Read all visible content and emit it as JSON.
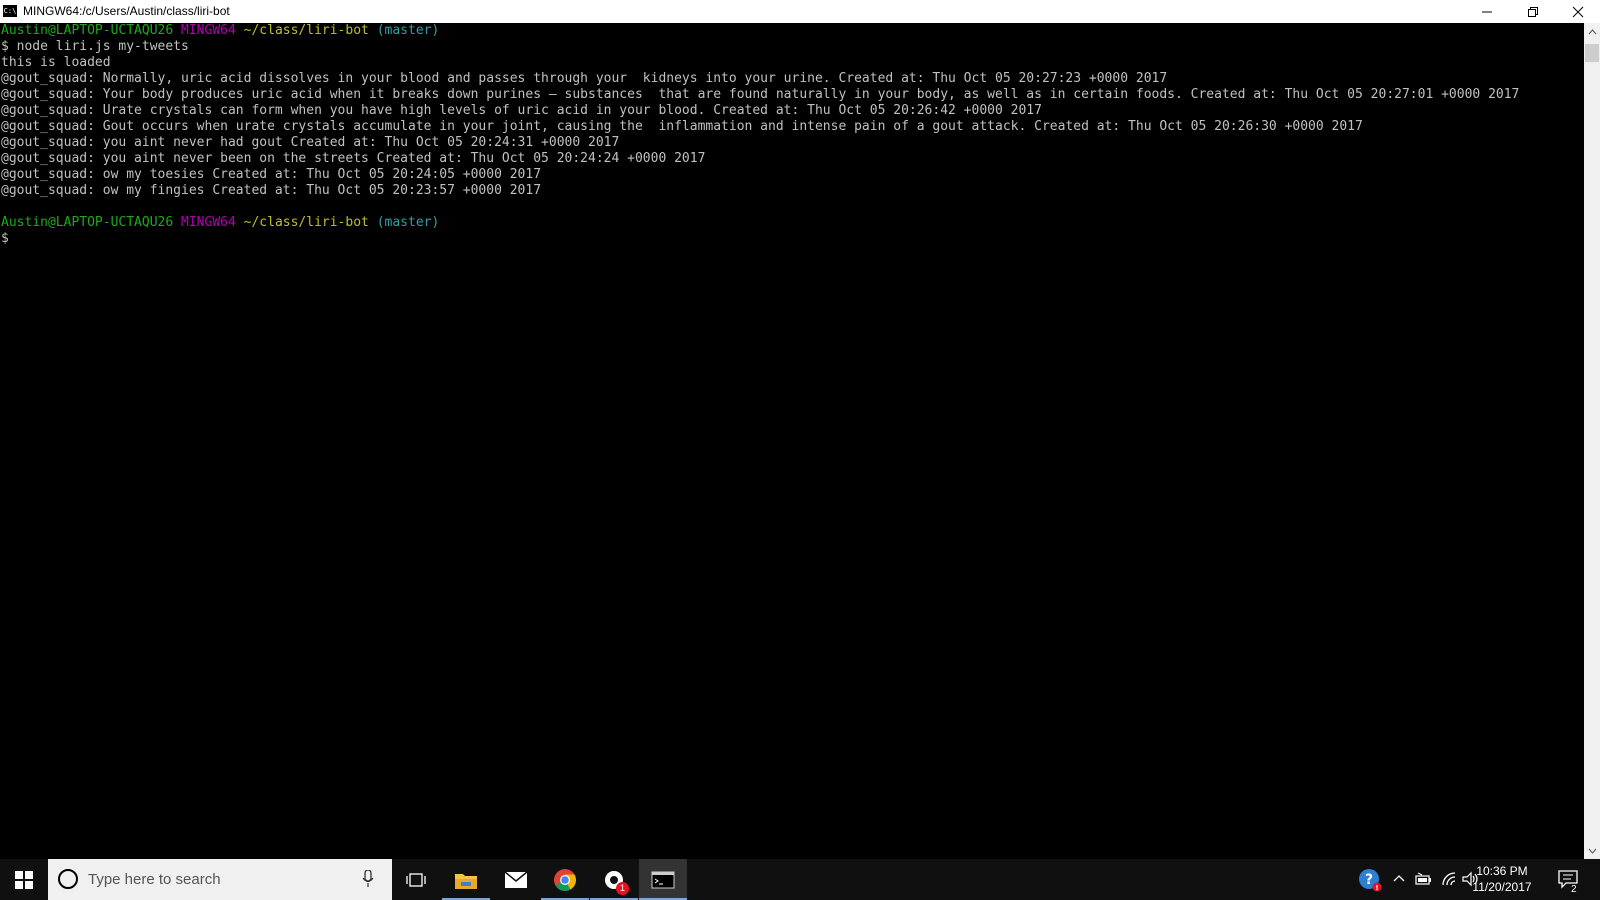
{
  "window": {
    "title": "MINGW64:/c/Users/Austin/class/liri-bot",
    "app_icon_text": "C:\\"
  },
  "terminal": {
    "prompt1": {
      "user": "Austin@LAPTOP-UCTAQU26",
      "system": "MINGW64",
      "path": "~/class/liri-bot",
      "branch": "(master)"
    },
    "command": "$ node liri.js my-tweets",
    "output": [
      "this is loaded",
      "@gout_squad: Normally, uric acid dissolves in your blood and passes through your  kidneys into your urine. Created at: Thu Oct 05 20:27:23 +0000 2017",
      "@gout_squad: Your body produces uric acid when it breaks down purines — substances  that are found naturally in your body, as well as in certain foods. Created at: Thu Oct 05 20:27:01 +0000 2017",
      "@gout_squad: Urate crystals can form when you have high levels of uric acid in your blood. Created at: Thu Oct 05 20:26:42 +0000 2017",
      "@gout_squad: Gout occurs when urate crystals accumulate in your joint, causing the  inflammation and intense pain of a gout attack. Created at: Thu Oct 05 20:26:30 +0000 2017",
      "@gout_squad: you aint never had gout Created at: Thu Oct 05 20:24:31 +0000 2017",
      "@gout_squad: you aint never been on the streets Created at: Thu Oct 05 20:24:24 +0000 2017",
      "@gout_squad: ow my toesies Created at: Thu Oct 05 20:24:05 +0000 2017",
      "@gout_squad: ow my fingies Created at: Thu Oct 05 20:23:57 +0000 2017"
    ],
    "prompt2": {
      "user": "Austin@LAPTOP-UCTAQU26",
      "system": "MINGW64",
      "path": "~/class/liri-bot",
      "branch": "(master)"
    },
    "cursor_line": "$"
  },
  "taskbar": {
    "search_placeholder": "Type here to search",
    "pinned": [
      "windows-start-icon",
      "task-view-icon",
      "file-explorer-icon",
      "mail-icon",
      "chrome-icon",
      "app-icon",
      "terminal-icon"
    ],
    "app_badge": "1",
    "clock_time": "10:36 PM",
    "clock_date": "11/20/2017",
    "notification_count": "2"
  },
  "colors": {
    "user": "#1ca91c",
    "system": "#b000b0",
    "path": "#bfbf28",
    "branch": "#2aa3a3",
    "text": "#c0c0c0",
    "taskbar": "#101010"
  }
}
